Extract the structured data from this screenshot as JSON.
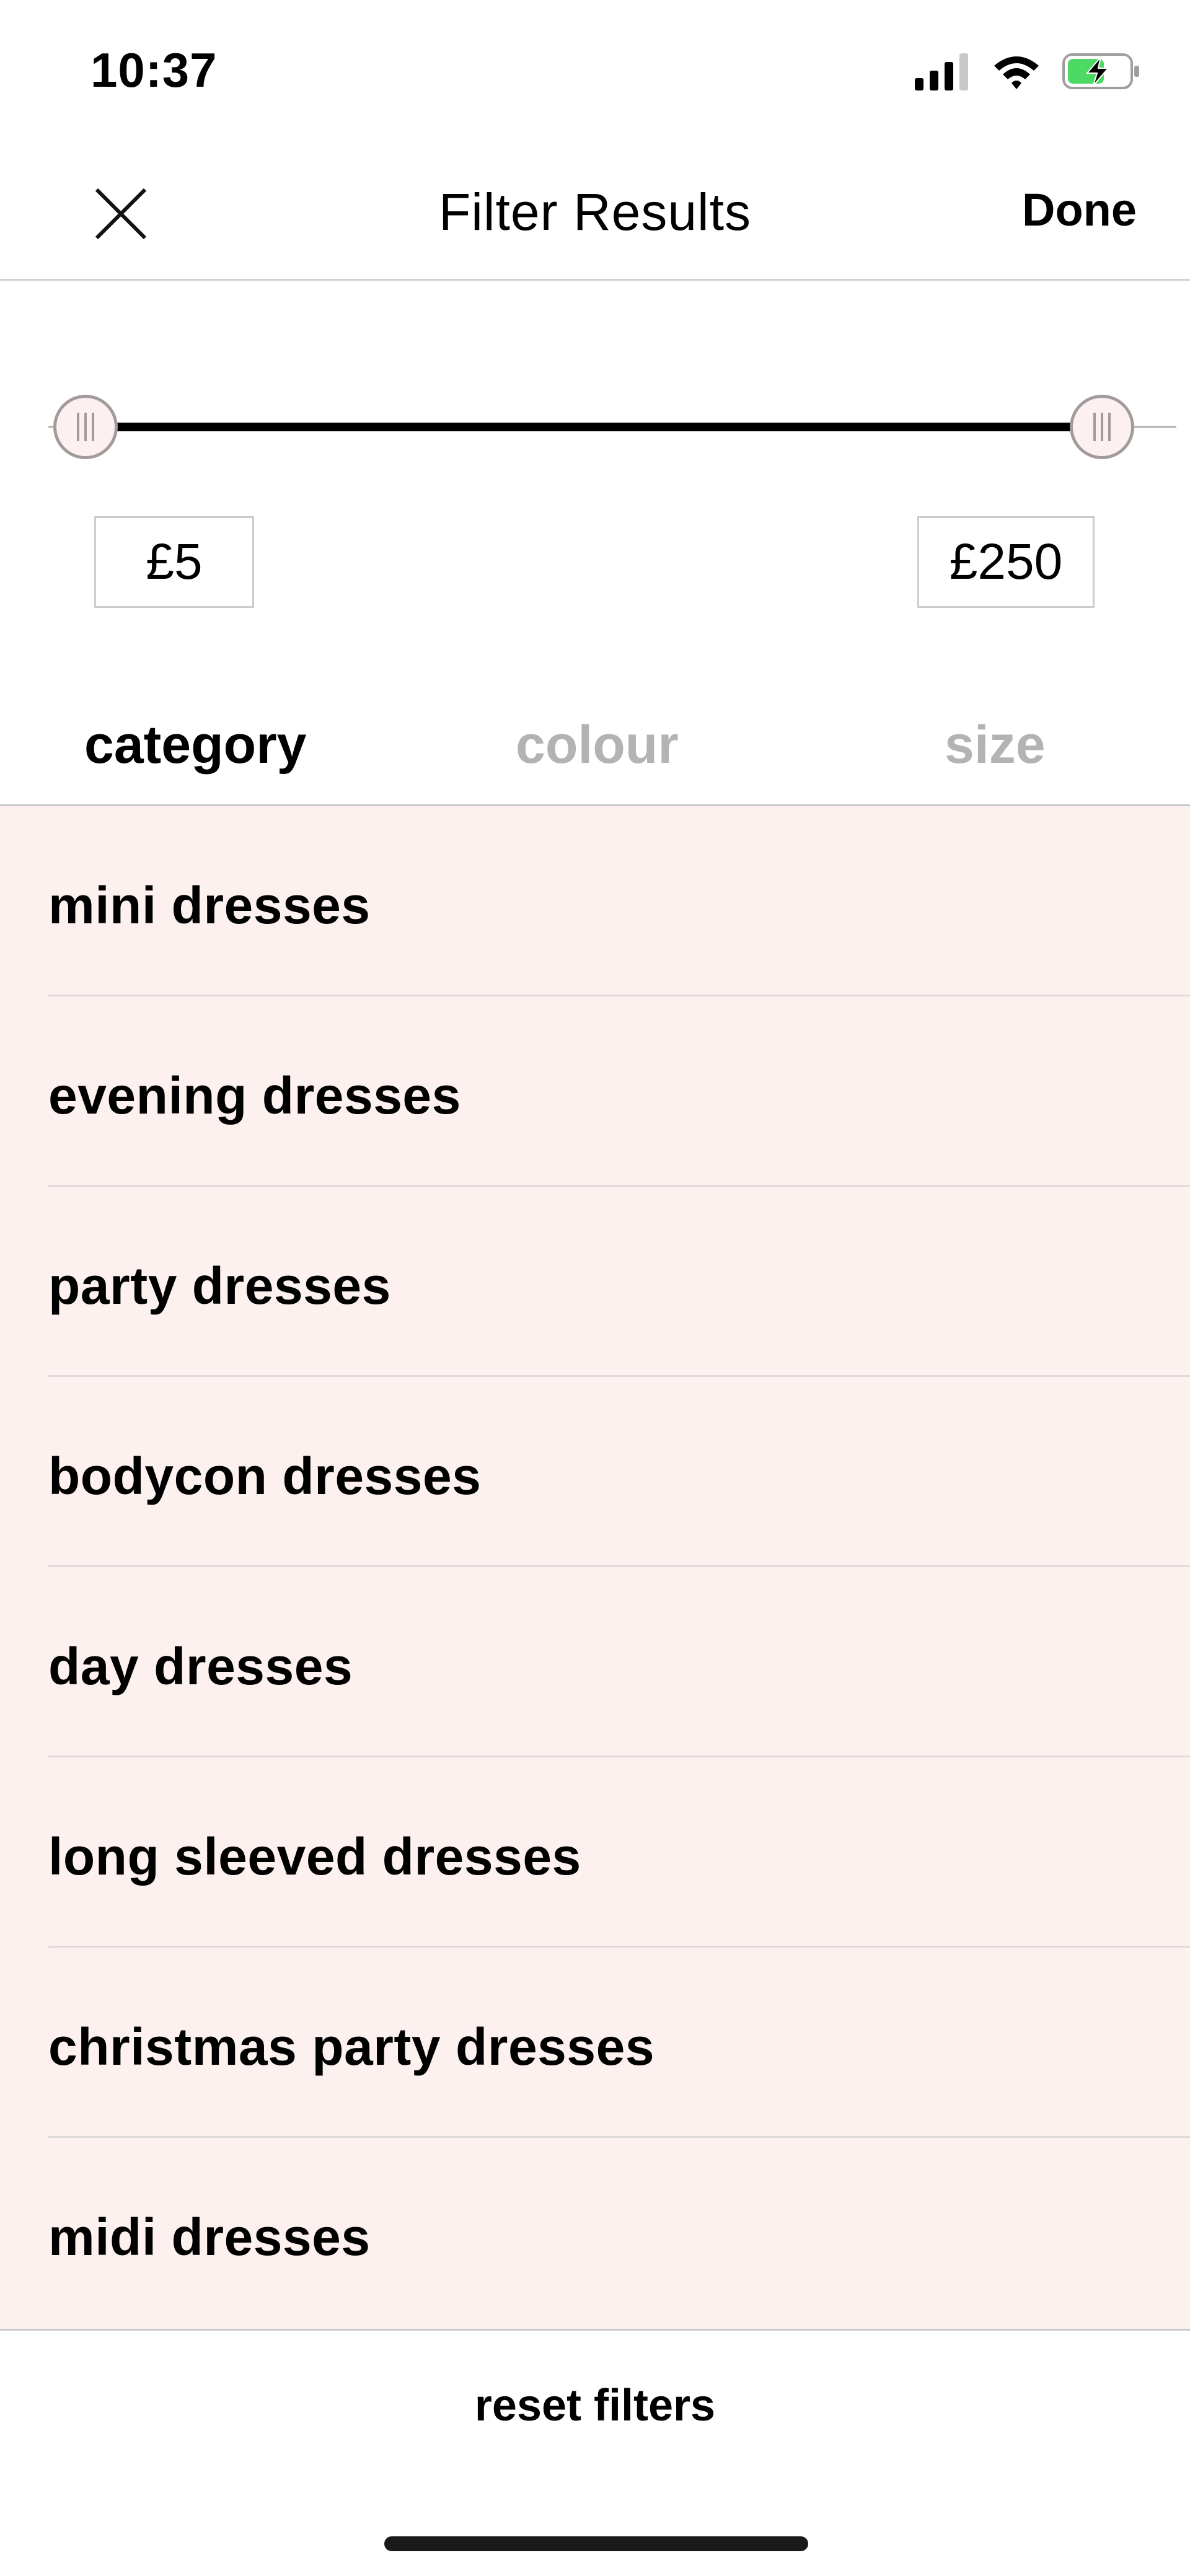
{
  "status_bar": {
    "time": "10:37",
    "icons": [
      "cellular-signal-icon",
      "wifi-icon",
      "battery-charging-icon"
    ],
    "battery_color": "#4cd964"
  },
  "header": {
    "close_icon": "close-icon",
    "title": "Filter Results",
    "done_label": "Done"
  },
  "price_filter": {
    "min_value": "£5",
    "max_value": "£250",
    "slider_min_fraction": 0,
    "slider_max_fraction": 1
  },
  "tabs": [
    {
      "label": "category",
      "active": true
    },
    {
      "label": "colour",
      "active": false
    },
    {
      "label": "size",
      "active": false
    }
  ],
  "categories": [
    {
      "label": "mini dresses"
    },
    {
      "label": "evening dresses"
    },
    {
      "label": "party dresses"
    },
    {
      "label": "bodycon dresses"
    },
    {
      "label": "day dresses"
    },
    {
      "label": "long sleeved dresses"
    },
    {
      "label": "christmas party dresses"
    },
    {
      "label": "midi dresses"
    }
  ],
  "footer": {
    "reset_label": "reset filters"
  },
  "colors": {
    "list_background": "#fdf1f0",
    "inactive_tab": "#b3b3b3",
    "active_text": "#000000"
  }
}
